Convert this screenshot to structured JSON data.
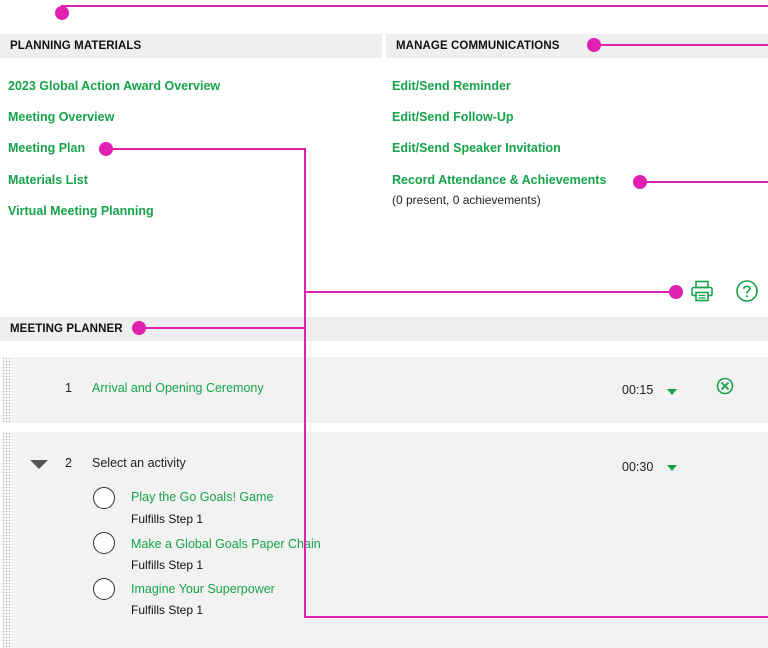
{
  "planning_materials": {
    "header": "PLANNING MATERIALS",
    "links": [
      "2023 Global Action Award Overview",
      "Meeting Overview",
      "Meeting Plan",
      "Materials List",
      "Virtual Meeting Planning"
    ]
  },
  "manage_communications": {
    "header": "MANAGE COMMUNICATIONS",
    "links": [
      "Edit/Send Reminder",
      "Edit/Send Follow-Up",
      "Edit/Send Speaker Invitation",
      "Record Attendance & Achievements"
    ],
    "attendance_summary": "(0 present, 0 achievements)"
  },
  "toolbar": {
    "print_icon": "printer-icon",
    "help_icon": "help-icon"
  },
  "meeting_planner": {
    "header": "MEETING PLANNER",
    "rows": [
      {
        "number": "1",
        "title": "Arrival and Opening Ceremony",
        "duration": "00:15"
      },
      {
        "number": "2",
        "title": "Select an activity",
        "duration": "00:30",
        "options": [
          {
            "label": "Play the Go Goals! Game",
            "fulfills": "Fulfills Step 1"
          },
          {
            "label": "Make a Global Goals Paper Chain",
            "fulfills": "Fulfills Step 1"
          },
          {
            "label": "Imagine Your Superpower",
            "fulfills": "Fulfills Step 1"
          }
        ]
      }
    ]
  },
  "colors": {
    "link_green": "#17a34a",
    "callout_magenta": "#e020b0",
    "header_gray": "#efefef"
  }
}
